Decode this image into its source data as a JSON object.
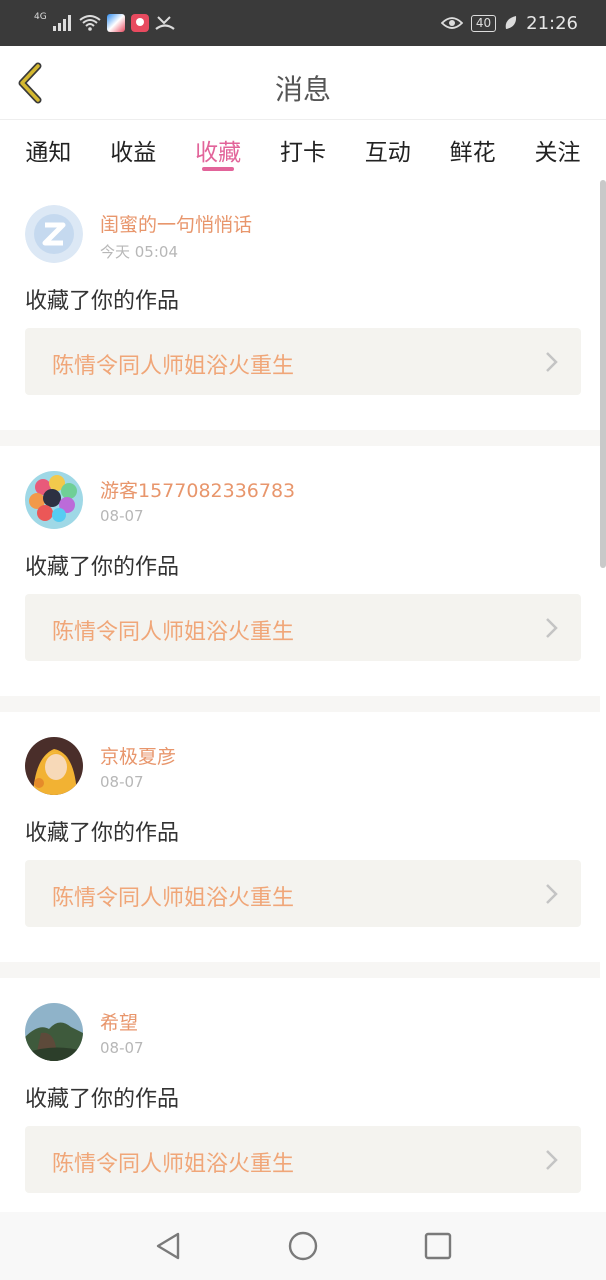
{
  "status_bar": {
    "network": "4G",
    "battery": "40",
    "time": "21:26",
    "icons": [
      "signal-icon",
      "wifi-icon",
      "app-notification-icon",
      "app-notification-icon",
      "missed-call-icon",
      "eye-comfort-icon",
      "battery-icon",
      "leaf-icon"
    ]
  },
  "header": {
    "title": "消息",
    "back_icon": "chevron-left-icon",
    "accent": "#d4b830"
  },
  "tabs": [
    {
      "label": "通知"
    },
    {
      "label": "收益"
    },
    {
      "label": "收藏"
    },
    {
      "label": "打卡"
    },
    {
      "label": "互动"
    },
    {
      "label": "鲜花"
    },
    {
      "label": "关注"
    }
  ],
  "active_tab": "收藏",
  "colors": {
    "active_tab": "#e2649a",
    "username": "#e8966c",
    "work_title": "#f0a678",
    "card_box": "#f4f3ef"
  },
  "notifications": [
    {
      "username": "闺蜜的一句悄悄话",
      "time": "今天 05:04",
      "action": "收藏了你的作品",
      "work": "陈情令同人师姐浴火重生",
      "avatar": "default-avatar"
    },
    {
      "username": "游客1577082336783",
      "time": "08-07",
      "action": "收藏了你的作品",
      "work": "陈情令同人师姐浴火重生",
      "avatar": "balloons-avatar"
    },
    {
      "username": "京极夏彦",
      "time": "08-07",
      "action": "收藏了你的作品",
      "work": "陈情令同人师姐浴火重生",
      "avatar": "anime-avatar"
    },
    {
      "username": "希望",
      "time": "08-07",
      "action": "收藏了你的作品",
      "work": "陈情令同人师姐浴火重生",
      "avatar": "landscape-avatar"
    }
  ],
  "nav_bar": {
    "icons": [
      "back-triangle-icon",
      "home-circle-icon",
      "recents-square-icon"
    ]
  }
}
